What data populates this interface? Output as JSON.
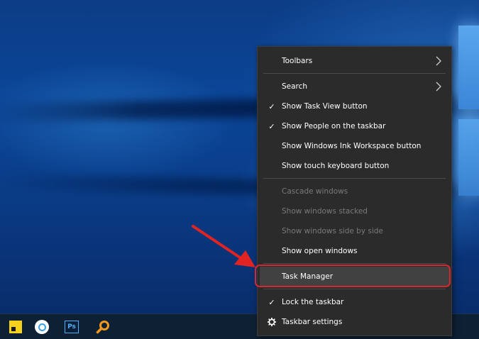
{
  "desktop": {
    "wallpaper": "windows-10-hero",
    "accent_color": "#0b4597"
  },
  "taskbar": {
    "apps": [
      {
        "name": "Sticky Notes",
        "icon": "sticky-notes-icon"
      },
      {
        "name": "Browser",
        "icon": "browser-icon"
      },
      {
        "name": "Photoshop",
        "icon": "photoshop-icon",
        "glyph": "Ps"
      },
      {
        "name": "Search",
        "icon": "magnifier-icon"
      }
    ]
  },
  "context_menu": {
    "items": [
      {
        "label": "Toolbars",
        "submenu": true,
        "checked": false,
        "enabled": true
      },
      {
        "label": "Search",
        "submenu": true,
        "checked": false,
        "enabled": true
      },
      {
        "label": "Show Task View button",
        "checked": true,
        "enabled": true
      },
      {
        "label": "Show People on the taskbar",
        "checked": true,
        "enabled": true
      },
      {
        "label": "Show Windows Ink Workspace button",
        "checked": false,
        "enabled": true
      },
      {
        "label": "Show touch keyboard button",
        "checked": false,
        "enabled": true
      },
      {
        "label": "Cascade windows",
        "checked": false,
        "enabled": false
      },
      {
        "label": "Show windows stacked",
        "checked": false,
        "enabled": false
      },
      {
        "label": "Show windows side by side",
        "checked": false,
        "enabled": false
      },
      {
        "label": "Show open windows",
        "checked": false,
        "enabled": true
      },
      {
        "label": "Task Manager",
        "checked": false,
        "enabled": true,
        "highlighted": true
      },
      {
        "label": "Lock the taskbar",
        "checked": true,
        "enabled": true
      },
      {
        "label": "Taskbar settings",
        "icon": "gear-icon",
        "checked": false,
        "enabled": true
      }
    ]
  },
  "annotation": {
    "arrow_color": "#e02424",
    "ring_color": "#d7272f"
  }
}
